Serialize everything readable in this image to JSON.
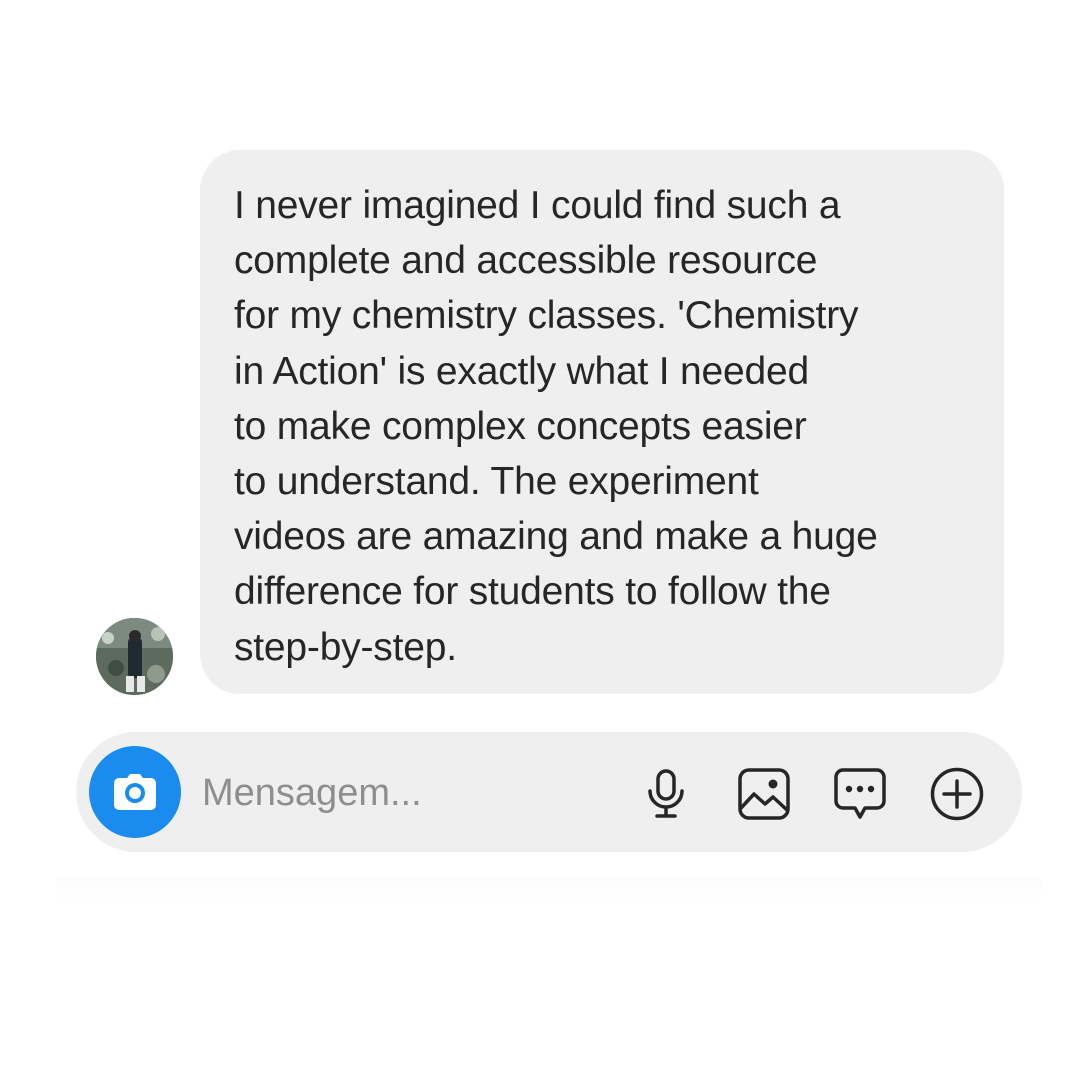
{
  "message": {
    "text": "I never imagined I could find such a\ncomplete and accessible resource\nfor my chemistry classes. 'Chemistry\nin Action' is exactly what I needed\nto make complex concepts easier\nto understand. The experiment\nvideos are amazing and make a huge\ndifference for students to follow the\nstep-by-step.",
    "bubble_color": "#efefef",
    "text_color": "#262626"
  },
  "sender": {
    "avatar_icon": "avatar"
  },
  "composer": {
    "placeholder": "Mensagem...",
    "accent_color": "#1a8cf0",
    "icons": [
      "camera-icon",
      "microphone-icon",
      "image-gallery-icon",
      "sticker-chat-icon",
      "plus-circle-icon"
    ]
  }
}
